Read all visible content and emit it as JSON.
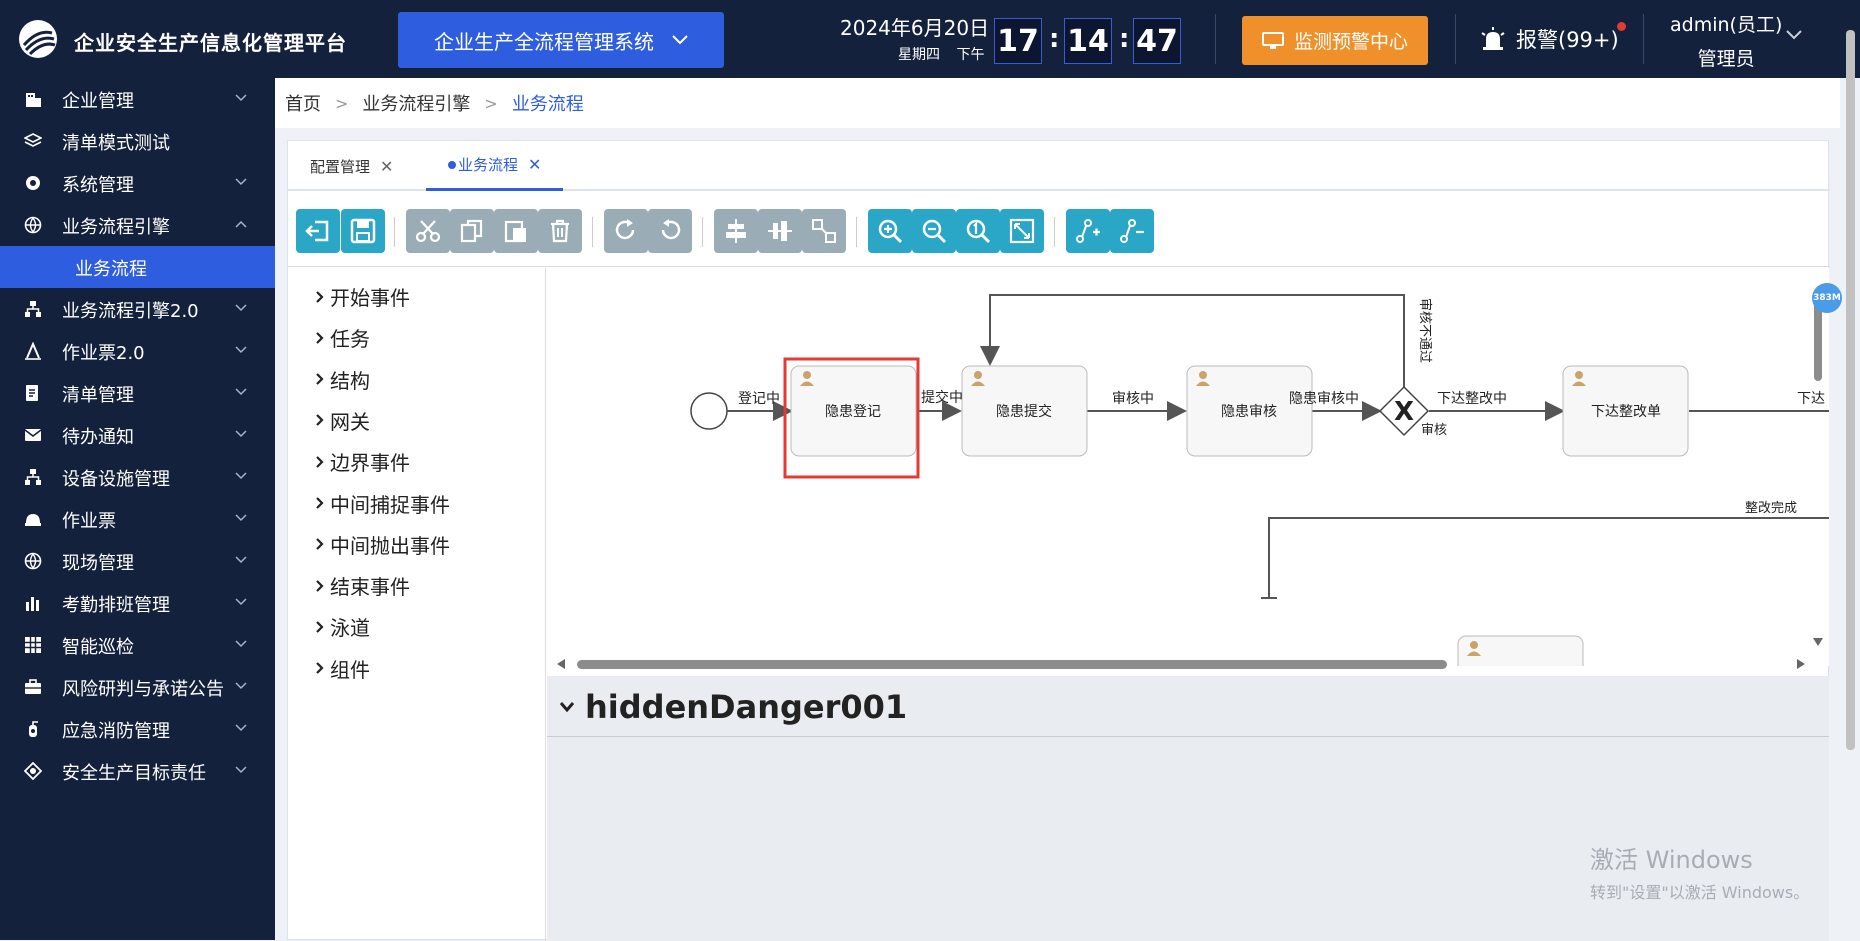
{
  "header": {
    "app_title": "企业安全生产信息化管理平台",
    "system_select": "企业生产全流程管理系统",
    "date": "2024年6月20日",
    "weekday": "星期四",
    "ampm": "下午",
    "clock": {
      "h": "17",
      "m": "14",
      "s": "47"
    },
    "monitor_button": "监测预警中心",
    "alarm": "报警(99+)",
    "user_name": "admin(员工)",
    "user_role": "管理员"
  },
  "sidebar": {
    "items": [
      {
        "label": "企业管理",
        "icon": "building-icon",
        "chevron": "down"
      },
      {
        "label": "清单模式测试",
        "icon": "layers-icon",
        "chevron": ""
      },
      {
        "label": "系统管理",
        "icon": "gear-icon",
        "chevron": "down"
      },
      {
        "label": "业务流程引擎",
        "icon": "globe-icon",
        "chevron": "up"
      },
      {
        "label": "业务流程",
        "icon": "",
        "chevron": "",
        "active": true
      },
      {
        "label": "业务流程引擎2.0",
        "icon": "hierarchy-icon",
        "chevron": "down"
      },
      {
        "label": "作业票2.0",
        "icon": "pen-icon",
        "chevron": "down"
      },
      {
        "label": "清单管理",
        "icon": "list-doc-icon",
        "chevron": "down"
      },
      {
        "label": "待办通知",
        "icon": "mail-icon",
        "chevron": "down"
      },
      {
        "label": "设备设施管理",
        "icon": "hierarchy-icon",
        "chevron": "down"
      },
      {
        "label": "作业票",
        "icon": "helmet-icon",
        "chevron": "down"
      },
      {
        "label": "现场管理",
        "icon": "globe-icon",
        "chevron": "down"
      },
      {
        "label": "考勤排班管理",
        "icon": "bar-chart-icon",
        "chevron": "down"
      },
      {
        "label": "智能巡检",
        "icon": "grid-icon",
        "chevron": "down"
      },
      {
        "label": "风险研判与承诺公告",
        "icon": "briefcase-icon",
        "chevron": "down"
      },
      {
        "label": "应急消防管理",
        "icon": "fire-extinguisher-icon",
        "chevron": "down"
      },
      {
        "label": "安全生产目标责任",
        "icon": "target-icon",
        "chevron": "down"
      }
    ]
  },
  "breadcrumb": {
    "home": "首页",
    "parent": "业务流程引擎",
    "current": "业务流程"
  },
  "tabs": [
    {
      "label": "配置管理",
      "active": false
    },
    {
      "label": "业务流程",
      "active": true
    }
  ],
  "palette": [
    "开始事件",
    "任务",
    "结构",
    "网关",
    "边界事件",
    "中间捕捉事件",
    "中间抛出事件",
    "结束事件",
    "泳道",
    "组件"
  ],
  "diagram": {
    "tasks": [
      "隐患登记",
      "隐患提交",
      "隐患审核",
      "下达整改单"
    ],
    "flows": [
      "登记中",
      "提交中",
      "审核中",
      "隐患审核中",
      "下达整改中",
      "下达",
      "审核",
      "审核不通过",
      "整改完成"
    ]
  },
  "zoom_badge": "383M",
  "properties": {
    "title": "hiddenDanger001"
  },
  "watermark": {
    "line1": "激活 Windows",
    "line2": "转到\"设置\"以激活 Windows。"
  }
}
